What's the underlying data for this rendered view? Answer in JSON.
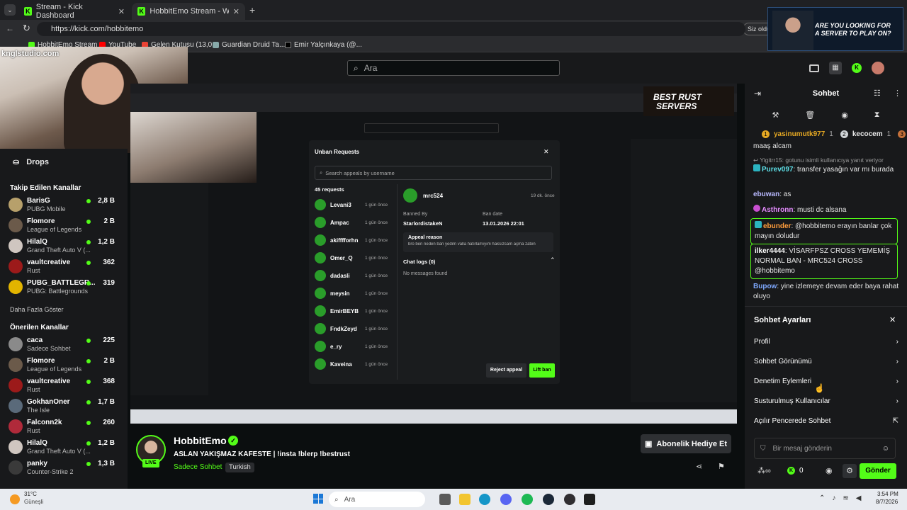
{
  "browser": {
    "tabs": [
      {
        "title": "Stream - Kick Dashboard"
      },
      {
        "title": "HobbitEmo Stream - Watch Live o"
      }
    ],
    "url": "https://kick.com/hobbitemo",
    "profile_label": "Siz oldu",
    "bookmarks": [
      "HobbitEmo Stream",
      "YouTube",
      "Gelen Kutusu (13,0...",
      "Guardian Druid Ta...",
      "Emir Yalçınkaya (@..."
    ]
  },
  "watermark": "knglstudio.com",
  "promo": {
    "line1": "ARE YOU LOOKING FOR",
    "line2": "A SERVER TO PLAY ON?"
  },
  "header": {
    "search_placeholder": "Ara"
  },
  "sidebar": {
    "drops_label": "Drops",
    "followed_title": "Takip Edilen Kanallar",
    "followed": [
      {
        "name": "BarisG",
        "game": "PUBG Mobile",
        "viewers": "2,8 B",
        "color": "#b7a06b"
      },
      {
        "name": "Flomore",
        "game": "League of Legends",
        "viewers": "2 B",
        "color": "#6b5a4a"
      },
      {
        "name": "HilalQ",
        "game": "Grand Theft Auto V (...",
        "viewers": "1,2 B",
        "color": "#cfc6c0"
      },
      {
        "name": "vaultcreative",
        "game": "Rust",
        "viewers": "362",
        "color": "#9c1a1a"
      },
      {
        "name": "PUBG_BATTLEGR...",
        "game": "PUBG: Battlegrounds",
        "viewers": "319",
        "color": "#e2b400"
      }
    ],
    "more_label": "Daha Fazla Göster",
    "suggested_title": "Önerilen Kanallar",
    "suggested": [
      {
        "name": "caca",
        "game": "Sadece Sohbet",
        "viewers": "225",
        "color": "#8a8a8a"
      },
      {
        "name": "Flomore",
        "game": "League of Legends",
        "viewers": "2 B",
        "color": "#6b5a4a"
      },
      {
        "name": "vaultcreative",
        "game": "Rust",
        "viewers": "368",
        "color": "#9c1a1a"
      },
      {
        "name": "GokhanOner",
        "game": "The Isle",
        "viewers": "1,7 B",
        "color": "#5a6a7a"
      },
      {
        "name": "Falconn2k",
        "game": "Rust",
        "viewers": "260",
        "color": "#b02a3a"
      },
      {
        "name": "HilalQ",
        "game": "Grand Theft Auto V (...",
        "viewers": "1,2 B",
        "color": "#cfc6c0"
      },
      {
        "name": "panky",
        "game": "Counter-Strike 2",
        "viewers": "1,3 B",
        "color": "#3a3a3a"
      }
    ]
  },
  "stream_modal": {
    "title": "Unban Requests",
    "search_placeholder": "Search appeals by username",
    "count": "45 requests",
    "requests": [
      {
        "name": "Levani3",
        "time": "1 gün önce"
      },
      {
        "name": "Ampac",
        "time": "1 gün önce"
      },
      {
        "name": "akifffforhn",
        "time": "1 gün önce"
      },
      {
        "name": "Omer_Q",
        "time": "1 gün önce"
      },
      {
        "name": "dadasli",
        "time": "1 gün önce"
      },
      {
        "name": "meysin",
        "time": "1 gün önce"
      },
      {
        "name": "EmirBEYB",
        "time": "1 gün önce"
      },
      {
        "name": "FndkZeyd",
        "time": "1 gün önce"
      },
      {
        "name": "e_ry",
        "time": "1 gün önce"
      },
      {
        "name": "Kaveina",
        "time": "1 gün önce"
      }
    ],
    "selected_user": "mrc524",
    "selected_time": "19 dk. önce",
    "banned_by_label": "Banned By",
    "banned_by": "StarlordistakeN",
    "ban_date_label": "Ban date",
    "ban_date": "13.01.2026 22:01",
    "appeal_reason_label": "Appeal reason",
    "appeal_reason": "bro ben neden ban yedim valla hatırlamıyım haksızsam açma zaten",
    "chat_logs_label": "Chat logs (0)",
    "no_messages": "No messages found",
    "reject_label": "Reject appeal",
    "lift_label": "Lift ban"
  },
  "stream_overlay": {
    "best_rust_line1": "BEST RUST",
    "best_rust_line2": "SERVERS"
  },
  "channel": {
    "name": "HobbitEmo",
    "live_badge": "LIVE",
    "title": "ASLAN YAKIŞMAZ KAFESTE | !insta !blerp !bestrust",
    "category": "Sadece Sohbet",
    "language": "Turkish",
    "gift_label": "Abonelik Hediye Et"
  },
  "chat": {
    "title": "Sohbet",
    "top_users": [
      {
        "name": "yasinumutk977",
        "count": "1"
      },
      {
        "name": "kecocem",
        "count": "1"
      }
    ],
    "messages": [
      {
        "user": "",
        "text": "maaş alcam",
        "color": "#e6e6e6"
      },
      {
        "user": "",
        "text": "Yigitrr15: gotunu isimli kullanıcıya yanıt veriyor",
        "color": "#9a9a9a"
      },
      {
        "user": "Purev097",
        "text": "transfer yasağın var mı burada",
        "color": "#e6e6e6"
      },
      {
        "user": "ebuwan",
        "text": "as",
        "color": "#e6e6e6"
      },
      {
        "user": "Asthronn",
        "text": "musti dc alsana",
        "color": "#e6e6e6"
      },
      {
        "user": "ebunder",
        "text": "@hobbitemo erayın banlar çok mayın doludur",
        "color": "#e6e6e6"
      },
      {
        "user": "ilker4444",
        "text": "VİSARFPSZ CROSS YEMEMİŞ NORMAL BAN - MRC524 CROSS @hobbitemo",
        "color": "#e6e6e6"
      },
      {
        "user": "Bupow",
        "text": "yine izlemeye devam eder baya rahat oluyo",
        "color": "#e6e6e6"
      }
    ],
    "settings_title": "Sohbet Ayarları",
    "settings_items": [
      "Profil",
      "Sohbet Görünümü",
      "Denetim Eylemleri",
      "Susturulmuş Kullanıcılar",
      "Açılır Pencerede Sohbet"
    ],
    "input_placeholder": "Bir mesaj gönderin",
    "points": "0",
    "send_label": "Gönder"
  },
  "taskbar": {
    "weather_temp": "31°C",
    "weather_desc": "Güneşli",
    "search_placeholder": "Ara",
    "time": "3:54 PM",
    "date": "8/7/2026"
  }
}
